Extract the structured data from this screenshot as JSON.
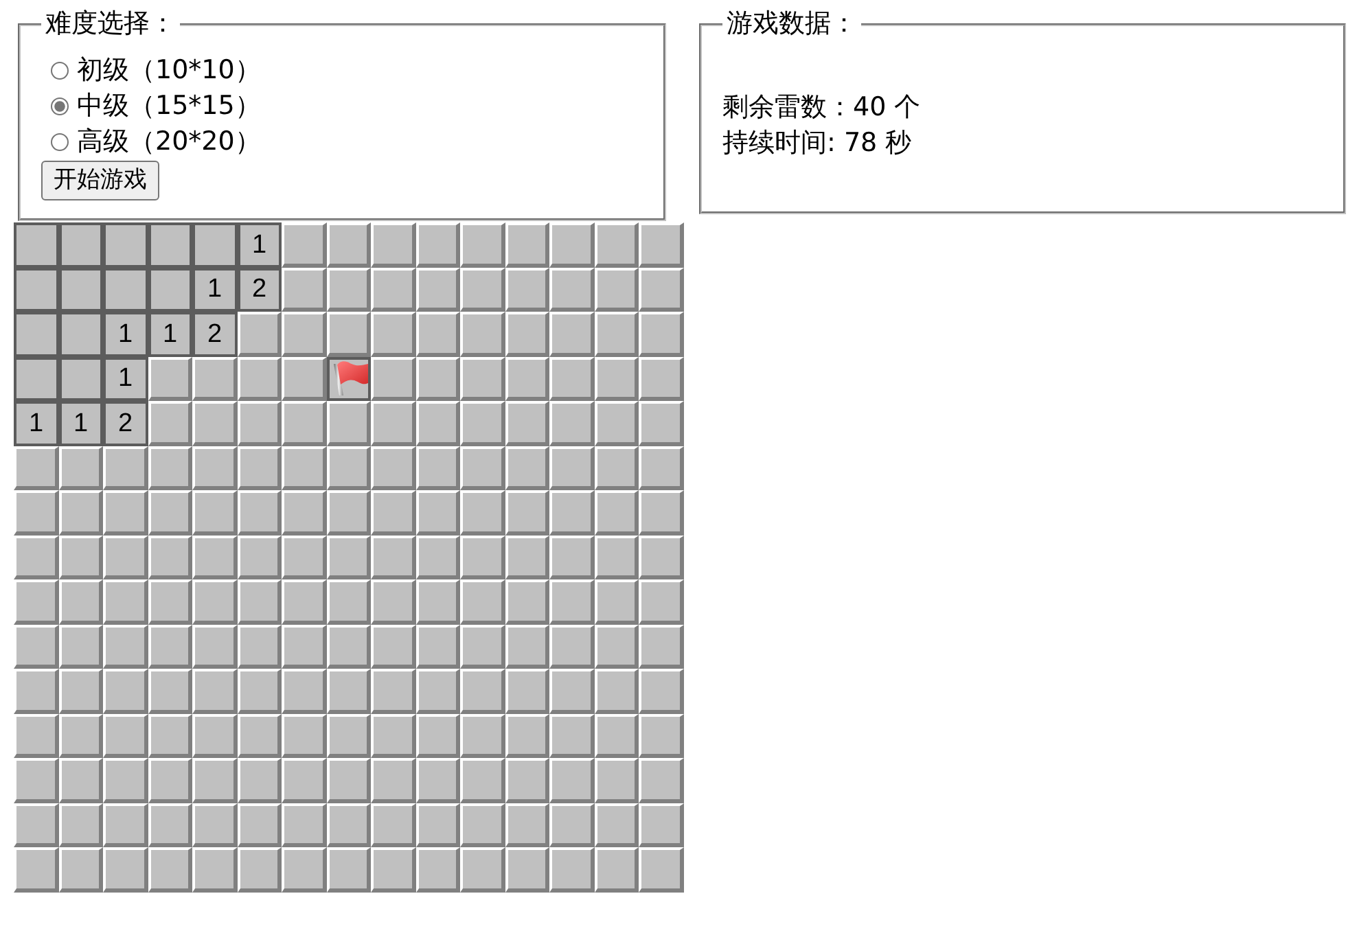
{
  "difficulty": {
    "legend": "难度选择：",
    "options": [
      {
        "label": "初级（10*10）",
        "selected": false
      },
      {
        "label": "中级（15*15）",
        "selected": true
      },
      {
        "label": "高级（20*20）",
        "selected": false
      }
    ],
    "start_button": "开始游戏"
  },
  "stats": {
    "legend": "游戏数据：",
    "lines": [
      "剩余雷数：40 个",
      "持续时间: 78 秒"
    ]
  },
  "board": {
    "rows": [
      [
        {
          "kind": "open"
        },
        {
          "kind": "open"
        },
        {
          "kind": "open"
        },
        {
          "kind": "open"
        },
        {
          "kind": "open"
        },
        {
          "kind": "open",
          "text": "1"
        },
        {
          "kind": "closed"
        },
        {
          "kind": "closed"
        },
        {
          "kind": "closed"
        },
        {
          "kind": "closed"
        },
        {
          "kind": "closed"
        },
        {
          "kind": "closed"
        },
        {
          "kind": "closed"
        },
        {
          "kind": "closed"
        },
        {
          "kind": "closed"
        }
      ],
      [
        {
          "kind": "open"
        },
        {
          "kind": "open"
        },
        {
          "kind": "open"
        },
        {
          "kind": "open"
        },
        {
          "kind": "open",
          "text": "1"
        },
        {
          "kind": "open",
          "text": "2"
        },
        {
          "kind": "closed"
        },
        {
          "kind": "closed"
        },
        {
          "kind": "closed"
        },
        {
          "kind": "closed"
        },
        {
          "kind": "closed"
        },
        {
          "kind": "closed"
        },
        {
          "kind": "closed"
        },
        {
          "kind": "closed"
        },
        {
          "kind": "closed"
        }
      ],
      [
        {
          "kind": "open"
        },
        {
          "kind": "open"
        },
        {
          "kind": "open",
          "text": "1"
        },
        {
          "kind": "open",
          "text": "1"
        },
        {
          "kind": "open",
          "text": "2"
        },
        {
          "kind": "closed"
        },
        {
          "kind": "closed"
        },
        {
          "kind": "closed"
        },
        {
          "kind": "closed"
        },
        {
          "kind": "closed"
        },
        {
          "kind": "closed"
        },
        {
          "kind": "closed"
        },
        {
          "kind": "closed"
        },
        {
          "kind": "closed"
        },
        {
          "kind": "closed"
        }
      ],
      [
        {
          "kind": "open"
        },
        {
          "kind": "open"
        },
        {
          "kind": "open",
          "text": "1"
        },
        {
          "kind": "closed"
        },
        {
          "kind": "closed"
        },
        {
          "kind": "closed"
        },
        {
          "kind": "closed"
        },
        {
          "kind": "flagged"
        },
        {
          "kind": "closed"
        },
        {
          "kind": "closed"
        },
        {
          "kind": "closed"
        },
        {
          "kind": "closed"
        },
        {
          "kind": "closed"
        },
        {
          "kind": "closed"
        },
        {
          "kind": "closed"
        }
      ],
      [
        {
          "kind": "open",
          "text": "1"
        },
        {
          "kind": "open",
          "text": "1"
        },
        {
          "kind": "open",
          "text": "2"
        },
        {
          "kind": "closed"
        },
        {
          "kind": "closed"
        },
        {
          "kind": "closed"
        },
        {
          "kind": "closed"
        },
        {
          "kind": "closed"
        },
        {
          "kind": "closed"
        },
        {
          "kind": "closed"
        },
        {
          "kind": "closed"
        },
        {
          "kind": "closed"
        },
        {
          "kind": "closed"
        },
        {
          "kind": "closed"
        },
        {
          "kind": "closed"
        }
      ],
      [
        {
          "kind": "closed"
        },
        {
          "kind": "closed"
        },
        {
          "kind": "closed"
        },
        {
          "kind": "closed"
        },
        {
          "kind": "closed"
        },
        {
          "kind": "closed"
        },
        {
          "kind": "closed"
        },
        {
          "kind": "closed"
        },
        {
          "kind": "closed"
        },
        {
          "kind": "closed"
        },
        {
          "kind": "closed"
        },
        {
          "kind": "closed"
        },
        {
          "kind": "closed"
        },
        {
          "kind": "closed"
        },
        {
          "kind": "closed"
        }
      ],
      [
        {
          "kind": "closed"
        },
        {
          "kind": "closed"
        },
        {
          "kind": "closed"
        },
        {
          "kind": "closed"
        },
        {
          "kind": "closed"
        },
        {
          "kind": "closed"
        },
        {
          "kind": "closed"
        },
        {
          "kind": "closed"
        },
        {
          "kind": "closed"
        },
        {
          "kind": "closed"
        },
        {
          "kind": "closed"
        },
        {
          "kind": "closed"
        },
        {
          "kind": "closed"
        },
        {
          "kind": "closed"
        },
        {
          "kind": "closed"
        }
      ],
      [
        {
          "kind": "closed"
        },
        {
          "kind": "closed"
        },
        {
          "kind": "closed"
        },
        {
          "kind": "closed"
        },
        {
          "kind": "closed"
        },
        {
          "kind": "closed"
        },
        {
          "kind": "closed"
        },
        {
          "kind": "closed"
        },
        {
          "kind": "closed"
        },
        {
          "kind": "closed"
        },
        {
          "kind": "closed"
        },
        {
          "kind": "closed"
        },
        {
          "kind": "closed"
        },
        {
          "kind": "closed"
        },
        {
          "kind": "closed"
        }
      ],
      [
        {
          "kind": "closed"
        },
        {
          "kind": "closed"
        },
        {
          "kind": "closed"
        },
        {
          "kind": "closed"
        },
        {
          "kind": "closed"
        },
        {
          "kind": "closed"
        },
        {
          "kind": "closed"
        },
        {
          "kind": "closed"
        },
        {
          "kind": "closed"
        },
        {
          "kind": "closed"
        },
        {
          "kind": "closed"
        },
        {
          "kind": "closed"
        },
        {
          "kind": "closed"
        },
        {
          "kind": "closed"
        },
        {
          "kind": "closed"
        }
      ],
      [
        {
          "kind": "closed"
        },
        {
          "kind": "closed"
        },
        {
          "kind": "closed"
        },
        {
          "kind": "closed"
        },
        {
          "kind": "closed"
        },
        {
          "kind": "closed"
        },
        {
          "kind": "closed"
        },
        {
          "kind": "closed"
        },
        {
          "kind": "closed"
        },
        {
          "kind": "closed"
        },
        {
          "kind": "closed"
        },
        {
          "kind": "closed"
        },
        {
          "kind": "closed"
        },
        {
          "kind": "closed"
        },
        {
          "kind": "closed"
        }
      ],
      [
        {
          "kind": "closed"
        },
        {
          "kind": "closed"
        },
        {
          "kind": "closed"
        },
        {
          "kind": "closed"
        },
        {
          "kind": "closed"
        },
        {
          "kind": "closed"
        },
        {
          "kind": "closed"
        },
        {
          "kind": "closed"
        },
        {
          "kind": "closed"
        },
        {
          "kind": "closed"
        },
        {
          "kind": "closed"
        },
        {
          "kind": "closed"
        },
        {
          "kind": "closed"
        },
        {
          "kind": "closed"
        },
        {
          "kind": "closed"
        }
      ],
      [
        {
          "kind": "closed"
        },
        {
          "kind": "closed"
        },
        {
          "kind": "closed"
        },
        {
          "kind": "closed"
        },
        {
          "kind": "closed"
        },
        {
          "kind": "closed"
        },
        {
          "kind": "closed"
        },
        {
          "kind": "closed"
        },
        {
          "kind": "closed"
        },
        {
          "kind": "closed"
        },
        {
          "kind": "closed"
        },
        {
          "kind": "closed"
        },
        {
          "kind": "closed"
        },
        {
          "kind": "closed"
        },
        {
          "kind": "closed"
        }
      ],
      [
        {
          "kind": "closed"
        },
        {
          "kind": "closed"
        },
        {
          "kind": "closed"
        },
        {
          "kind": "closed"
        },
        {
          "kind": "closed"
        },
        {
          "kind": "closed"
        },
        {
          "kind": "closed"
        },
        {
          "kind": "closed"
        },
        {
          "kind": "closed"
        },
        {
          "kind": "closed"
        },
        {
          "kind": "closed"
        },
        {
          "kind": "closed"
        },
        {
          "kind": "closed"
        },
        {
          "kind": "closed"
        },
        {
          "kind": "closed"
        }
      ],
      [
        {
          "kind": "closed"
        },
        {
          "kind": "closed"
        },
        {
          "kind": "closed"
        },
        {
          "kind": "closed"
        },
        {
          "kind": "closed"
        },
        {
          "kind": "closed"
        },
        {
          "kind": "closed"
        },
        {
          "kind": "closed"
        },
        {
          "kind": "closed"
        },
        {
          "kind": "closed"
        },
        {
          "kind": "closed"
        },
        {
          "kind": "closed"
        },
        {
          "kind": "closed"
        },
        {
          "kind": "closed"
        },
        {
          "kind": "closed"
        }
      ],
      [
        {
          "kind": "closed"
        },
        {
          "kind": "closed"
        },
        {
          "kind": "closed"
        },
        {
          "kind": "closed"
        },
        {
          "kind": "closed"
        },
        {
          "kind": "closed"
        },
        {
          "kind": "closed"
        },
        {
          "kind": "closed"
        },
        {
          "kind": "closed"
        },
        {
          "kind": "closed"
        },
        {
          "kind": "closed"
        },
        {
          "kind": "closed"
        },
        {
          "kind": "closed"
        },
        {
          "kind": "closed"
        },
        {
          "kind": "closed"
        }
      ]
    ]
  }
}
